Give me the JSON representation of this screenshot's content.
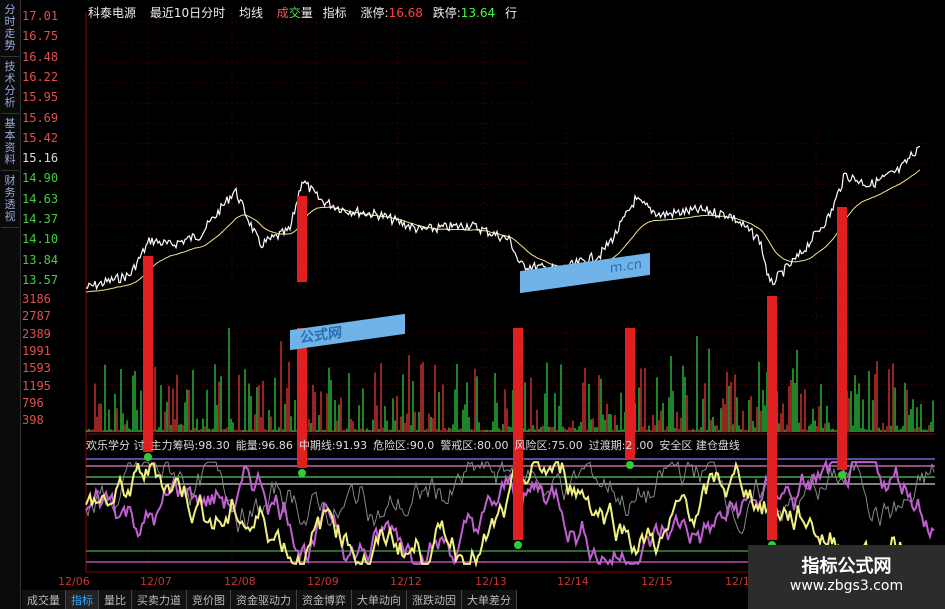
{
  "side_tabs": [
    "分时走势",
    "技术分析",
    "基本资料",
    "财务透视"
  ],
  "header": {
    "stock": "科泰电源",
    "period": "最近10日分时",
    "avg": "均线",
    "vol_1": "成",
    "vol_2": "交",
    "vol_3": "量",
    "indicator": "指标",
    "limit_up_label": "涨停:",
    "limit_up": "16.68",
    "limit_down_label": "跌停:",
    "limit_down": "13.64",
    "more": "行"
  },
  "price_axis": [
    "17.01",
    "16.75",
    "16.48",
    "16.22",
    "15.95",
    "15.69",
    "15.42",
    "15.16",
    "14.90",
    "14.63",
    "14.37",
    "14.10",
    "13.84",
    "13.57"
  ],
  "volume_axis": [
    "3186",
    "2787",
    "2389",
    "1991",
    "1593",
    "1195",
    "796",
    "398"
  ],
  "indicator_line": [
    {
      "text": "欢乐学分 讨",
      "color": "#dddddd"
    },
    {
      "text": "主力筹码:98.30",
      "color": "#dddddd"
    },
    {
      "text": "能量:96.86",
      "color": "#dddddd"
    },
    {
      "text": "中期线:91.93",
      "color": "#dddddd"
    },
    {
      "text": "危险区:90.0",
      "color": "#dddddd"
    },
    {
      "text": "警戒区:80.00",
      "color": "#dddddd"
    },
    {
      "text": "风险区:75.00",
      "color": "#dddddd"
    },
    {
      "text": "过渡期:2 .00",
      "color": "#dddddd"
    },
    {
      "text": "安全区 建仓盘线",
      "color": "#dddddd"
    }
  ],
  "dates": [
    "12/06",
    "12/07",
    "12/08",
    "12/09",
    "12/12",
    "12/13",
    "12/14",
    "12/15",
    "12/16"
  ],
  "bottom_tabs": [
    "成交量",
    "指标",
    "量比",
    "买卖力道",
    "竞价图",
    "资金驱动力",
    "资金博弈",
    "大单动向",
    "涨跌动因",
    "大单差分"
  ],
  "active_tab": "指标",
  "watermark": {
    "title": "指标公式网",
    "url": "www.zbgs3.com"
  },
  "stamp_text": "公式网",
  "stamp_text2": "m.cn",
  "colors": {
    "up": "#e02020",
    "limit_up": "#ff4040",
    "limit_down": "#40ff40",
    "price_line": "#ffffff",
    "avg_line": "#f0e68c",
    "green_vol": "#2ecc40",
    "red_vol": "#e53935",
    "pink_band": "#e080c0",
    "blue_band": "#7f7fff"
  },
  "red_bar_days": [
    "12/07",
    "12/09",
    "12/13",
    "12/14",
    "12/16"
  ]
}
